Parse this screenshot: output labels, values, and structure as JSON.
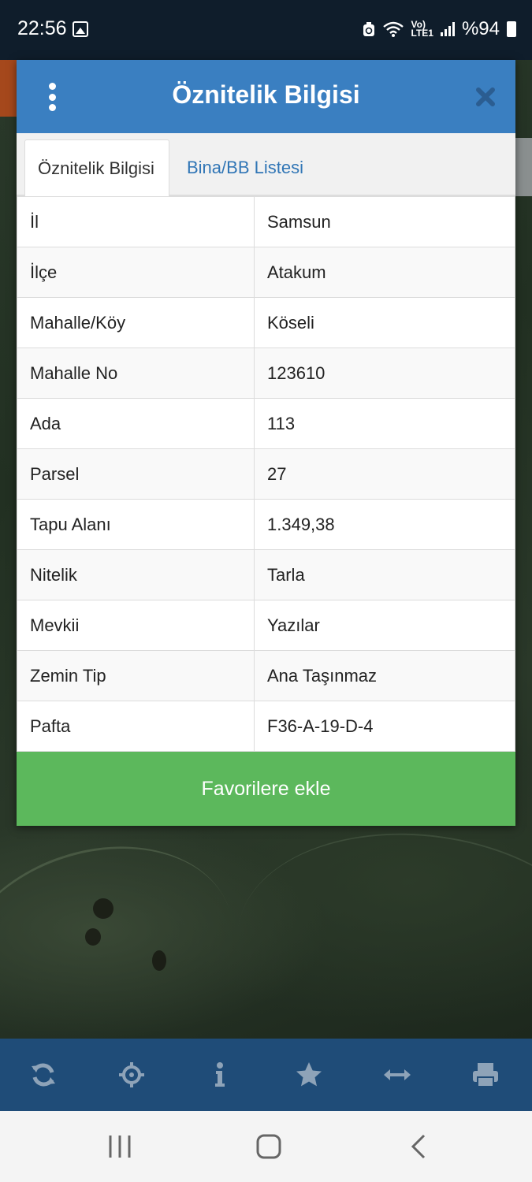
{
  "status_bar": {
    "time": "22:56",
    "network": "Vo)\nLTE1",
    "battery": "%94"
  },
  "modal": {
    "title": "Öznitelik Bilgisi",
    "tabs": [
      {
        "label": "Öznitelik Bilgisi",
        "active": true
      },
      {
        "label": "Bina/BB Listesi",
        "active": false
      }
    ],
    "rows": [
      {
        "key": "İl",
        "value": "Samsun"
      },
      {
        "key": "İlçe",
        "value": "Atakum"
      },
      {
        "key": "Mahalle/Köy",
        "value": "Köseli"
      },
      {
        "key": "Mahalle No",
        "value": "123610"
      },
      {
        "key": "Ada",
        "value": "113"
      },
      {
        "key": "Parsel",
        "value": "27"
      },
      {
        "key": "Tapu Alanı",
        "value": "1.349,38"
      },
      {
        "key": "Nitelik",
        "value": "Tarla"
      },
      {
        "key": "Mevkii",
        "value": "Yazılar"
      },
      {
        "key": "Zemin Tip",
        "value": "Ana Taşınmaz"
      },
      {
        "key": "Pafta",
        "value": "F36-A-19-D-4"
      }
    ],
    "favorite_button": "Favorilere ekle"
  },
  "toolbar": {
    "items": [
      "refresh-icon",
      "locate-icon",
      "info-icon",
      "star-icon",
      "measure-icon",
      "print-icon"
    ]
  },
  "colors": {
    "header": "#3a7fc1",
    "button": "#5cb85c",
    "toolbar": "#1f4c78",
    "tab_link": "#3176b6"
  }
}
